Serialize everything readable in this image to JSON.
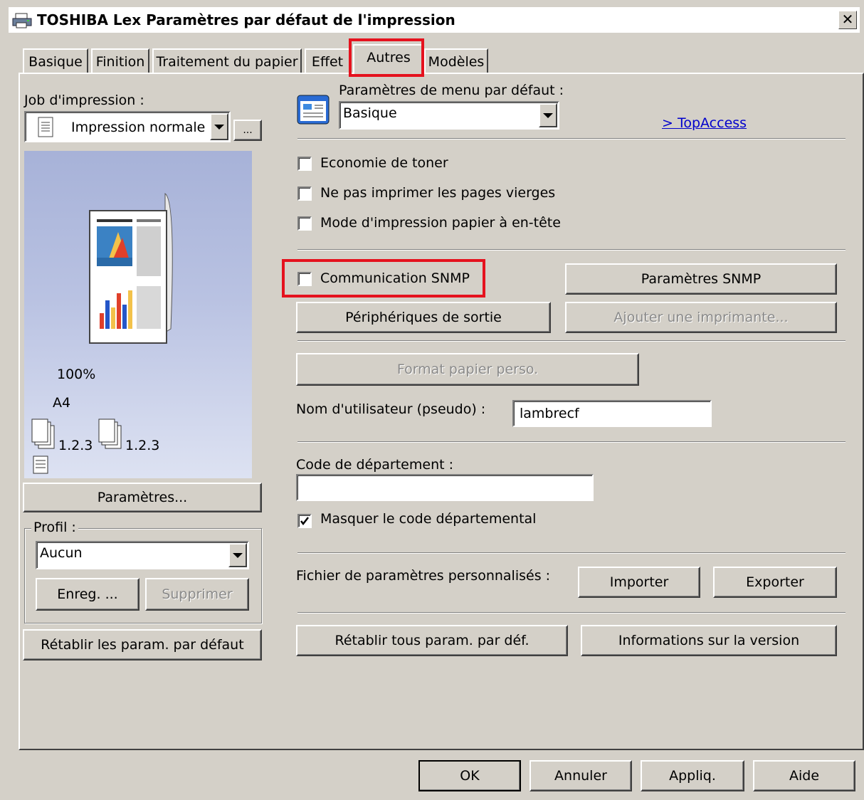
{
  "window": {
    "title": "TOSHIBA Lex Paramètres par défaut de l'impression",
    "close": "✕"
  },
  "tabs": [
    {
      "label": "Basique"
    },
    {
      "label": "Finition"
    },
    {
      "label": "Traitement du papier"
    },
    {
      "label": "Effet"
    },
    {
      "label": "Autres"
    },
    {
      "label": "Modèles"
    }
  ],
  "left": {
    "job_label": "Job d'impression :",
    "job_value": "Impression normale",
    "job_more": "...",
    "zoom": "100%",
    "paper": "A4",
    "copies_a": "1.2.3",
    "copies_b": "1.2.3",
    "params_button": "Paramètres...",
    "profile_label": "Profil :",
    "profile_value": "Aucun",
    "save_button": "Enreg. ...",
    "delete_button": "Supprimer",
    "reset_button": "Rétablir les param. par défaut"
  },
  "right": {
    "menu_label": "Paramètres de menu par défaut :",
    "menu_value": "Basique",
    "topaccess": "> TopAccess",
    "toner": "Economie de toner",
    "blank_pages": "Ne pas imprimer les pages vierges",
    "letterhead": "Mode d'impression papier à en-tête",
    "snmp_comm": "Communication SNMP",
    "snmp_params": "Paramètres SNMP",
    "output_devices": "Périphériques de sortie",
    "add_printer": "Ajouter une imprimante...",
    "custom_paper": "Format papier perso.",
    "username_label": "Nom d'utilisateur (pseudo) :",
    "username_value": "lambrecf",
    "dept_label": "Code de département :",
    "dept_value": "",
    "hide_dept": "Masquer le code départemental",
    "custom_file_label": "Fichier de paramètres personnalisés :",
    "import": "Importer",
    "export": "Exporter",
    "reset_all": "Rétablir tous param. par déf.",
    "version_info": "Informations sur la version"
  },
  "footer": {
    "ok": "OK",
    "cancel": "Annuler",
    "apply": "Appliq.",
    "help": "Aide"
  },
  "checks": {
    "toner": false,
    "blank_pages": false,
    "letterhead": false,
    "snmp": false,
    "hide_dept": true
  },
  "colors": {
    "highlight": "#e5121e",
    "dialog": "#d4d0c8",
    "link": "#0000cc"
  }
}
